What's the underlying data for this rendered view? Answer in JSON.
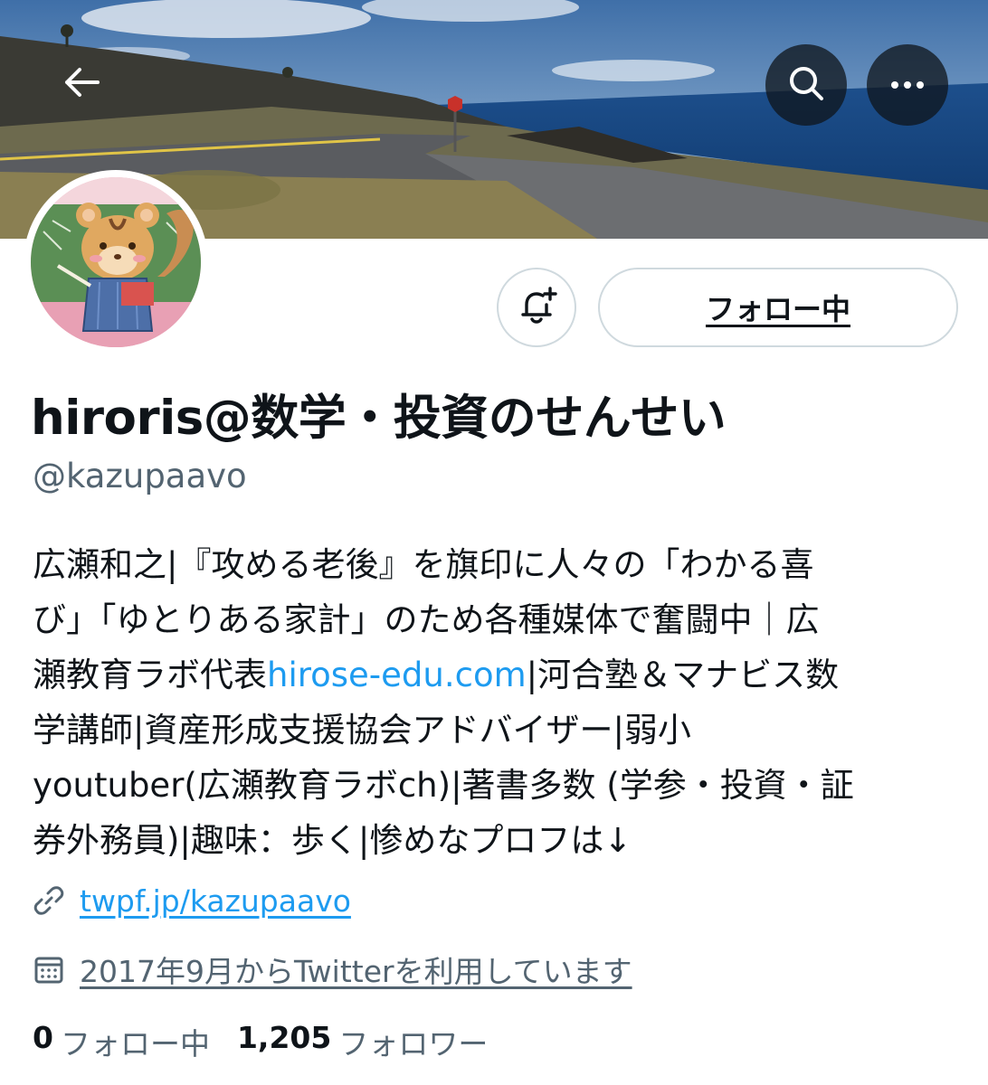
{
  "header": {
    "back_icon": "arrow-left-icon",
    "search_icon": "search-icon",
    "more_icon": "more-horizontal-icon"
  },
  "profile": {
    "display_name": "hiroris@数学・投資のせんせい",
    "handle": "@kazupaavo",
    "follow_button_label": "フォロー中",
    "notify_icon": "bell-plus-icon",
    "bio_lines": [
      [
        "広瀬和之|『攻める老後』を旗印に人々の「わかる喜",
        ""
      ],
      [
        "び」「ゆとりある家計」のため各種媒体で奮闘中｜広",
        ""
      ],
      [
        "瀬教育ラボ代表",
        "hirose-edu.com",
        "|河合塾＆マナビス数"
      ],
      [
        "学講師|資産形成支援協会アドバイザー|弱小",
        ""
      ],
      [
        "youtuber(広瀬教育ラボch)|著書多数 (学参・投資・証",
        ""
      ],
      [
        "券外務員)|趣味：歩く|惨めなプロフは↓",
        ""
      ]
    ],
    "url": "twpf.jp/kazupaavo",
    "joined": "2017年9月からTwitterを利用しています",
    "following_count": "0",
    "following_label": "フォロー中",
    "followers_count": "1,205",
    "followers_label": "フォロワー"
  },
  "colors": {
    "link": "#1d9bf0",
    "secondary_text": "#536471",
    "border": "#cfd9de"
  }
}
